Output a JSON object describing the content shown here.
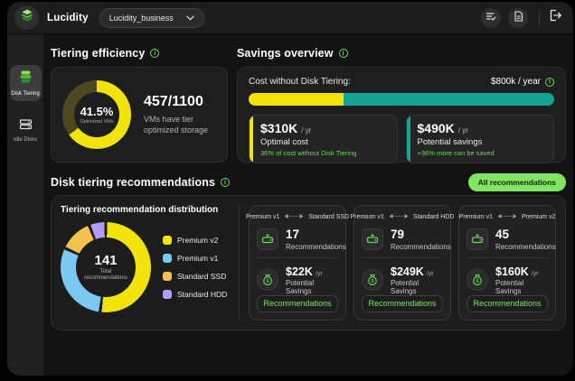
{
  "topbar": {
    "brand": "Lucidity",
    "org_selector": "Lucidity_business"
  },
  "sidebar": {
    "items": [
      {
        "label": "Disk Tiering",
        "active": true
      },
      {
        "label": "Idle Disks",
        "active": false
      }
    ]
  },
  "colors": {
    "yellow": "#F2E30B",
    "teal": "#12A594",
    "green_accent": "#67DA57",
    "pill_green": "#82E562",
    "blue": "#79C9F2",
    "orange": "#F2C14E",
    "purple": "#B49CF6",
    "donut_remainder": "#4C481F"
  },
  "tiering_efficiency": {
    "title": "Tiering efficiency",
    "ratio": "457/1100",
    "ratio_label": "VMs have tier optimized storage"
  },
  "savings_overview": {
    "title": "Savings overview",
    "cost_label": "Cost without Disk Tiering:",
    "cost_value": "$800k / year",
    "optimal": {
      "value": "$310K",
      "unit": "/ yr",
      "label": "Optimal cost",
      "note": "36% of cost without Disk Tiering"
    },
    "potential": {
      "value": "$490K",
      "unit": "/ yr",
      "label": "Potential savings",
      "note": "+36% more can be saved"
    }
  },
  "recommendations": {
    "title": "Disk tiering recommendations",
    "all_button": "All recommendations",
    "distribution_title": "Tiering recommendation distribution",
    "cards": [
      {
        "from": "Premium v1",
        "to": "Standard SSD",
        "count": "17",
        "count_label": "Recommendations",
        "savings": "$22K",
        "savings_unit": "/yr",
        "savings_label": "Potential Savings",
        "button": "Recommendations"
      },
      {
        "from": "Premium v1",
        "to": "Standard HDD",
        "count": "79",
        "count_label": "Recommendations",
        "savings": "$249K",
        "savings_unit": "/yr",
        "savings_label": "Potential Savings",
        "button": "Recommendations"
      },
      {
        "from": "Premium v1",
        "to": "Premium v2",
        "count": "45",
        "count_label": "Recommendations",
        "savings": "$160K",
        "savings_unit": "/yr",
        "savings_label": "Potential Savings",
        "button": "Recommendations"
      }
    ]
  },
  "chart_data": [
    {
      "id": "tiering-efficiency-donut",
      "type": "donut",
      "center_value": "41.5%",
      "center_label": "Optimized VMs",
      "optimized_vms": 457,
      "total_vms": 1100,
      "series": [
        {
          "pct": 65,
          "color": "#F2E30B"
        },
        {
          "pct": 35,
          "color": "#4C481F"
        }
      ]
    },
    {
      "id": "cost-without-tiering-bar",
      "type": "stacked-bar",
      "title": "Cost without Disk Tiering:",
      "total_label": "$800k / year",
      "series": [
        {
          "name": "Optimal cost",
          "value_k_per_yr": 310,
          "pct": 31,
          "color": "#F2E30B"
        },
        {
          "name": "Potential savings",
          "value_k_per_yr": 490,
          "pct": 69,
          "color": "#12A594"
        }
      ]
    },
    {
      "id": "distribution-donut",
      "type": "donut",
      "center_value": "141",
      "center_label": "Total recommendations",
      "series": [
        {
          "name": "Premium v2",
          "pct": 52,
          "color": "#F2E30B"
        },
        {
          "name": "Premium v1",
          "pct": 30,
          "color": "#79C9F2"
        },
        {
          "name": "Standard SSD",
          "pct": 12,
          "color": "#F2C14E"
        },
        {
          "name": "Standard HDD",
          "pct": 6,
          "color": "#B49CF6"
        }
      ]
    }
  ]
}
